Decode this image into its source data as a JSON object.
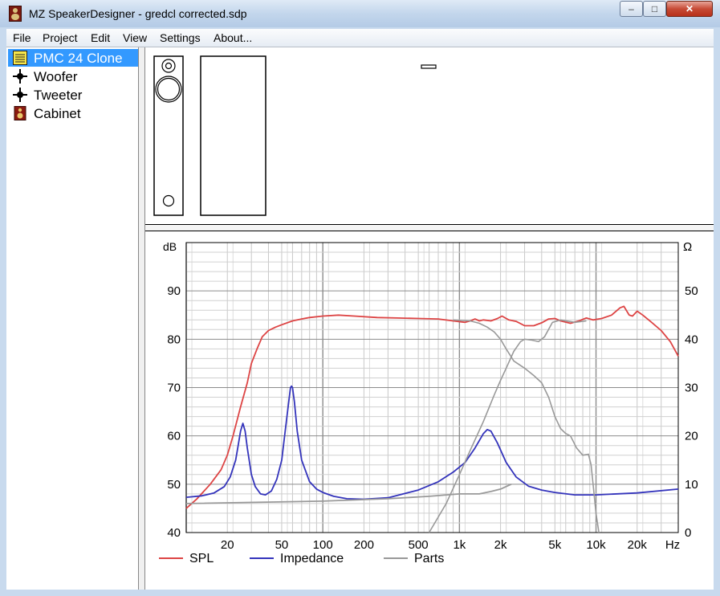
{
  "window": {
    "title": "MZ SpeakerDesigner - gredcl corrected.sdp",
    "buttons": {
      "minimize": "–",
      "maximize": "□",
      "close": "✕"
    }
  },
  "menu": [
    "File",
    "Project",
    "Edit",
    "View",
    "Settings",
    "About..."
  ],
  "tree": [
    {
      "label": "PMC 24 Clone",
      "icon": "project-icon",
      "selected": true
    },
    {
      "label": "Woofer",
      "icon": "driver-node-icon",
      "selected": false
    },
    {
      "label": "Tweeter",
      "icon": "driver-node-icon",
      "selected": false
    },
    {
      "label": "Cabinet",
      "icon": "cabinet-icon",
      "selected": false
    }
  ],
  "chart_data": {
    "type": "line",
    "x_scale": "log",
    "xlim": [
      10,
      40000
    ],
    "x_ticks": [
      "20",
      "50",
      "100",
      "200",
      "500",
      "1k",
      "2k",
      "5k",
      "10k",
      "20k",
      "Hz"
    ],
    "x_tick_values": [
      20,
      50,
      100,
      200,
      500,
      1000,
      2000,
      5000,
      10000,
      20000
    ],
    "left_axis": {
      "label": "dB",
      "lim": [
        40,
        100
      ],
      "ticks": [
        40,
        50,
        60,
        70,
        80,
        90
      ]
    },
    "right_axis": {
      "label": "Ω",
      "lim": [
        0,
        60
      ],
      "ticks": [
        0,
        10,
        20,
        30,
        40,
        50
      ]
    },
    "grid": true,
    "legend_position": "bottom",
    "series": [
      {
        "name": "SPL",
        "color": "#dd4444",
        "axis": "left",
        "points": [
          [
            10,
            45
          ],
          [
            12,
            47
          ],
          [
            15,
            50
          ],
          [
            18,
            53
          ],
          [
            20,
            56
          ],
          [
            22,
            60
          ],
          [
            25,
            66
          ],
          [
            28,
            71
          ],
          [
            30,
            75
          ],
          [
            33,
            78
          ],
          [
            36,
            80.5
          ],
          [
            40,
            81.8
          ],
          [
            45,
            82.5
          ],
          [
            50,
            83
          ],
          [
            60,
            83.8
          ],
          [
            70,
            84.2
          ],
          [
            80,
            84.5
          ],
          [
            100,
            84.8
          ],
          [
            130,
            85
          ],
          [
            170,
            84.8
          ],
          [
            250,
            84.5
          ],
          [
            350,
            84.4
          ],
          [
            500,
            84.3
          ],
          [
            700,
            84.2
          ],
          [
            900,
            83.8
          ],
          [
            1100,
            83.5
          ],
          [
            1200,
            83.8
          ],
          [
            1300,
            84.2
          ],
          [
            1400,
            83.8
          ],
          [
            1500,
            84
          ],
          [
            1700,
            83.8
          ],
          [
            1900,
            84.3
          ],
          [
            2050,
            84.8
          ],
          [
            2300,
            84
          ],
          [
            2600,
            83.7
          ],
          [
            3000,
            82.8
          ],
          [
            3500,
            82.8
          ],
          [
            4000,
            83.4
          ],
          [
            4500,
            84.2
          ],
          [
            5000,
            84.3
          ],
          [
            5500,
            83.8
          ],
          [
            6500,
            83.3
          ],
          [
            7500,
            83.8
          ],
          [
            8500,
            84.4
          ],
          [
            9500,
            84
          ],
          [
            11000,
            84.3
          ],
          [
            13000,
            85
          ],
          [
            15000,
            86.5
          ],
          [
            16000,
            86.8
          ],
          [
            17500,
            85
          ],
          [
            18500,
            84.8
          ],
          [
            20000,
            85.8
          ],
          [
            22000,
            85
          ],
          [
            25000,
            83.7
          ],
          [
            30000,
            81.8
          ],
          [
            35000,
            79.5
          ],
          [
            40000,
            76.5
          ]
        ]
      },
      {
        "name": "Impedance",
        "color": "#3333bb",
        "axis": "right",
        "points": [
          [
            10,
            7.3
          ],
          [
            13,
            7.6
          ],
          [
            16,
            8.2
          ],
          [
            19,
            9.5
          ],
          [
            21,
            11.5
          ],
          [
            23,
            15
          ],
          [
            24,
            18
          ],
          [
            25,
            21
          ],
          [
            26,
            22.6
          ],
          [
            27,
            21
          ],
          [
            28,
            17.5
          ],
          [
            30,
            12
          ],
          [
            32,
            9.5
          ],
          [
            35,
            8
          ],
          [
            38,
            7.8
          ],
          [
            42,
            8.6
          ],
          [
            46,
            11
          ],
          [
            50,
            15
          ],
          [
            53,
            21
          ],
          [
            56,
            26.5
          ],
          [
            58,
            30
          ],
          [
            59,
            30.3
          ],
          [
            60,
            30
          ],
          [
            62,
            27
          ],
          [
            65,
            21
          ],
          [
            70,
            15
          ],
          [
            80,
            10.5
          ],
          [
            90,
            9
          ],
          [
            100,
            8.3
          ],
          [
            120,
            7.5
          ],
          [
            150,
            7
          ],
          [
            200,
            6.9
          ],
          [
            300,
            7.2
          ],
          [
            500,
            8.8
          ],
          [
            700,
            10.5
          ],
          [
            900,
            12.5
          ],
          [
            1100,
            14.5
          ],
          [
            1300,
            17.5
          ],
          [
            1500,
            20.5
          ],
          [
            1600,
            21.3
          ],
          [
            1700,
            21
          ],
          [
            1900,
            18.5
          ],
          [
            2200,
            14.5
          ],
          [
            2600,
            11.5
          ],
          [
            3200,
            9.6
          ],
          [
            4000,
            8.8
          ],
          [
            5000,
            8.3
          ],
          [
            7000,
            7.8
          ],
          [
            10000,
            7.8
          ],
          [
            20000,
            8.2
          ],
          [
            40000,
            9
          ]
        ]
      },
      {
        "name": "Parts",
        "color": "#999999",
        "axis": "left",
        "points": [
          [
            10,
            46
          ],
          [
            100,
            46.5
          ],
          [
            300,
            47
          ],
          [
            600,
            47.5
          ],
          [
            1000,
            48
          ],
          [
            1400,
            48
          ],
          [
            1700,
            48.5
          ],
          [
            2000,
            49
          ],
          [
            2400,
            50
          ]
        ]
      }
    ]
  }
}
